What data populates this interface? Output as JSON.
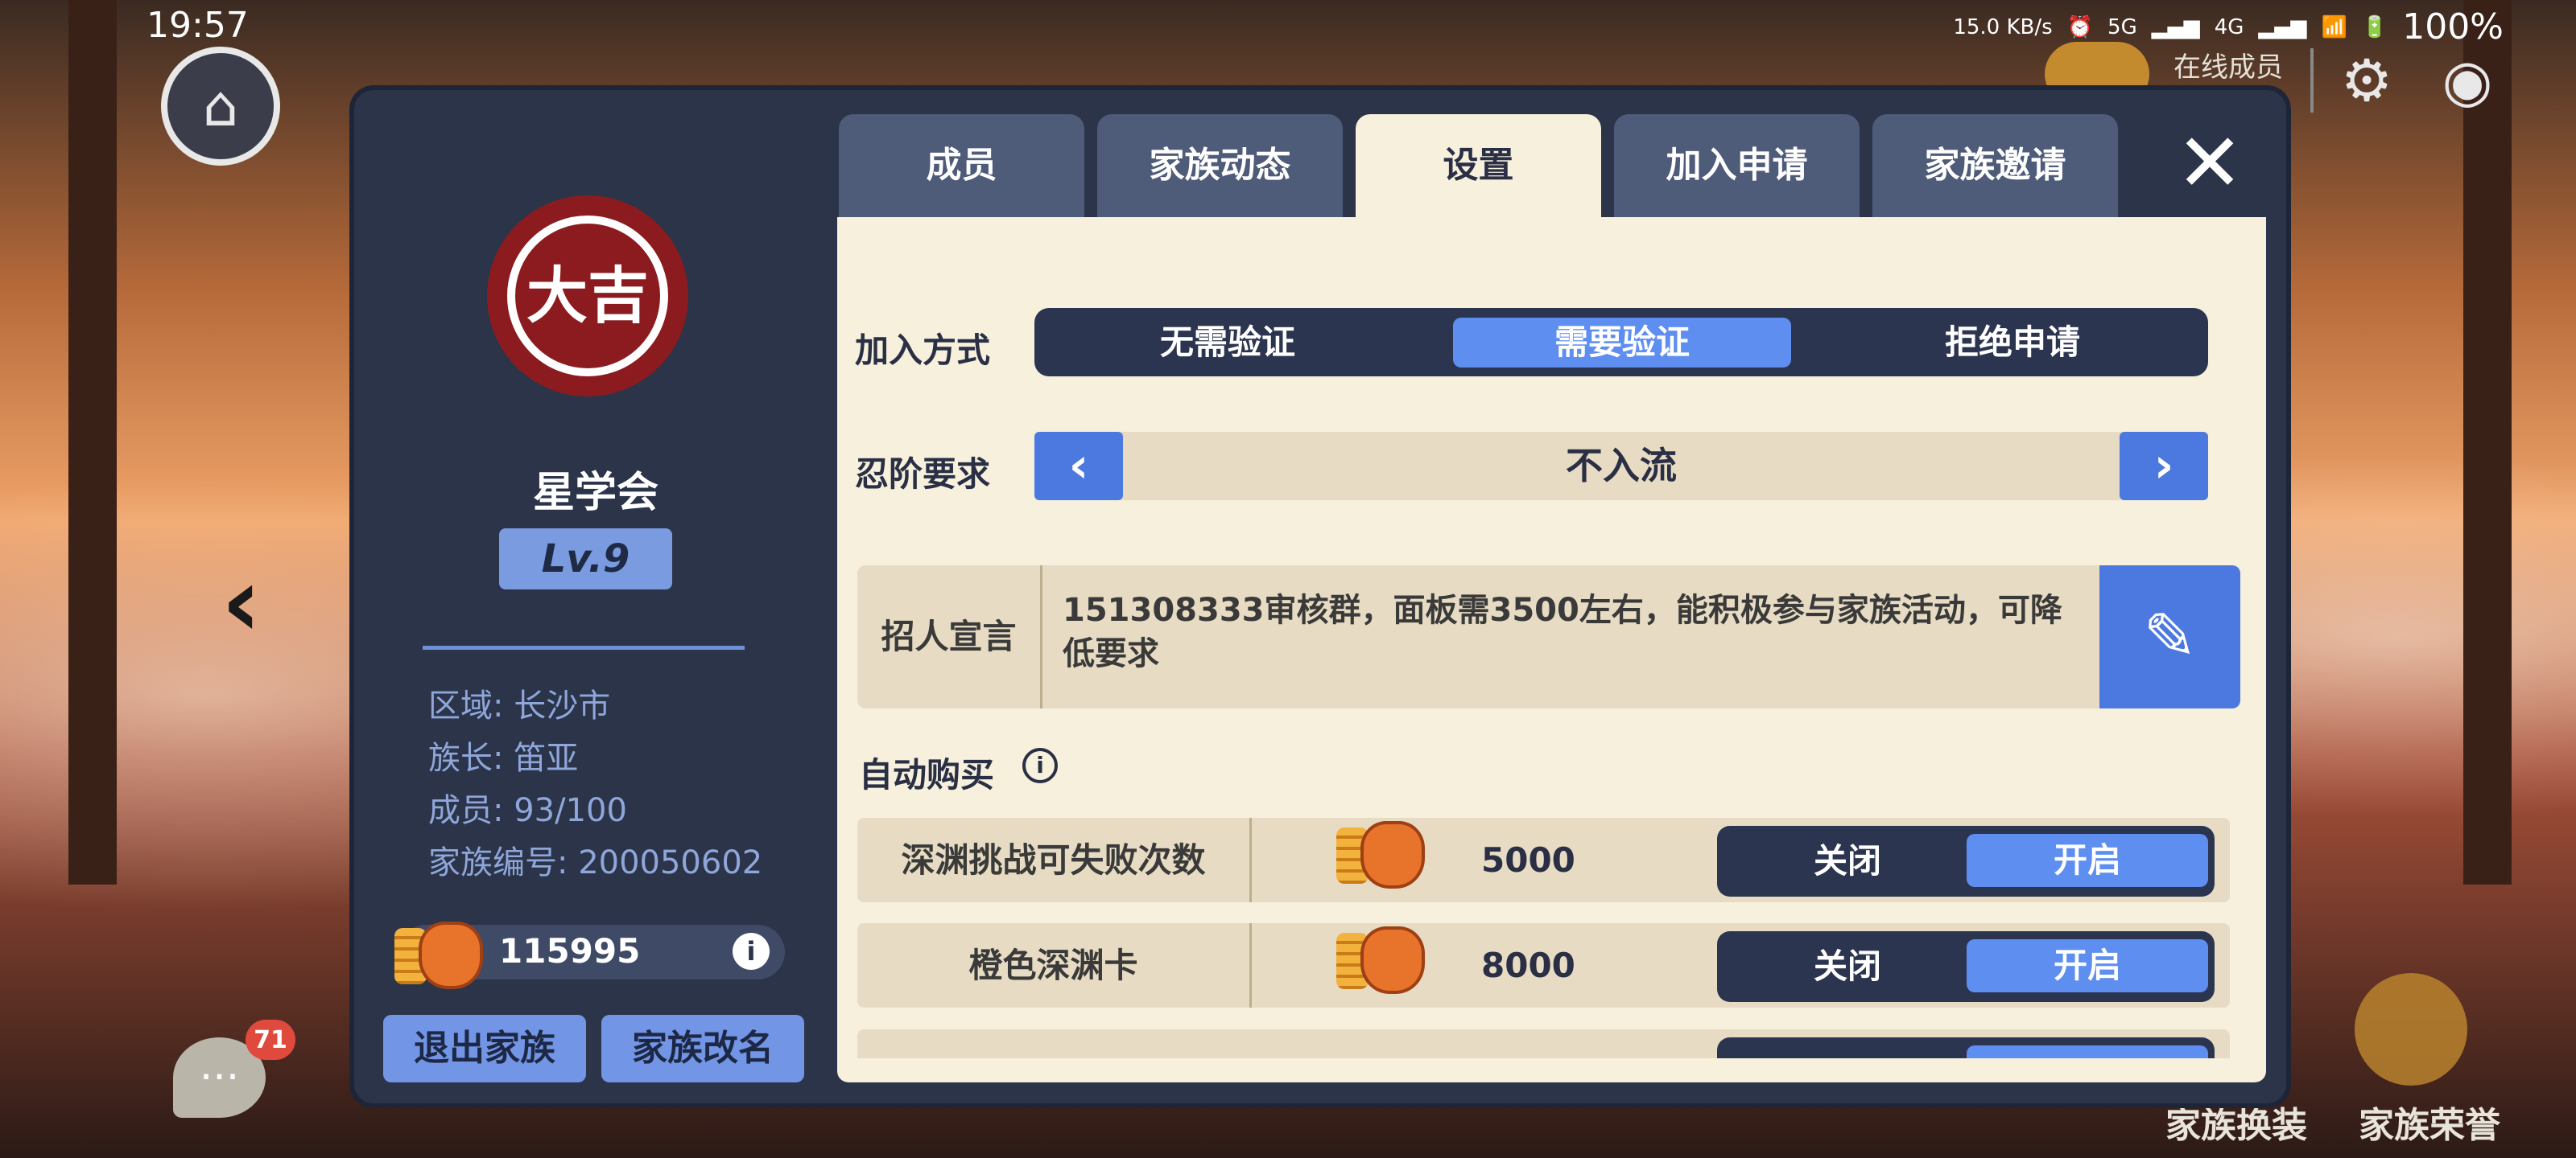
{
  "status_bar": {
    "time": "19:57",
    "net_speed": "15.0 KB/s",
    "signal_5g": "5G",
    "signal_4g": "4G",
    "battery": "100%"
  },
  "top_right": {
    "online_label": "在线成员",
    "bottom_buttons": [
      "家族换装",
      "家族荣誉"
    ]
  },
  "chat": {
    "badge_count": "71"
  },
  "family": {
    "emblem_text": "大吉",
    "name": "星学会",
    "level": "Lv.9",
    "info": [
      "区域: 长沙市",
      "族长: 笛亚",
      "成员: 93/100",
      "家族编号: 200050602"
    ],
    "coins": "115995",
    "buttons": [
      "退出家族",
      "家族改名"
    ]
  },
  "tabs": [
    {
      "label": "成员",
      "active": false
    },
    {
      "label": "家族动态",
      "active": false
    },
    {
      "label": "设置",
      "active": true
    },
    {
      "label": "加入申请",
      "active": false
    },
    {
      "label": "家族邀请",
      "active": false
    }
  ],
  "settings": {
    "join_label": "加入方式",
    "join_options": [
      "无需验证",
      "需要验证",
      "拒绝申请"
    ],
    "join_selected": 1,
    "rank_label": "忍阶要求",
    "rank_value": "不入流",
    "declaration_label": "招人宣言",
    "declaration_text": "151308333审核群，面板需3500左右，能积极参与家族活动，可降低要求",
    "auto_buy_label": "自动购买",
    "auto_buy_items": [
      {
        "name": "深渊挑战可失败次数",
        "price": "5000",
        "off": "关闭",
        "on": "开启",
        "state": "on"
      },
      {
        "name": "橙色深渊卡",
        "price": "8000",
        "off": "关闭",
        "on": "开启",
        "state": "on"
      }
    ]
  },
  "colors": {
    "panel_bg": "#2b3448",
    "content_bg": "#f6f0dc",
    "accent_blue": "#5e8ef0",
    "emblem_red": "#8c1b1f"
  }
}
